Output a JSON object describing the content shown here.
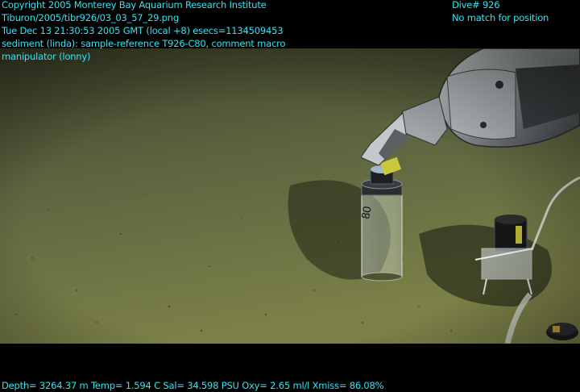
{
  "overlay": {
    "top_left": [
      "Copyright 2005 Monterey Bay Aquarium Research Institute",
      "Tiburon/2005/tibr926/03_03_57_29.png",
      "Tue Dec 13 21:30:53 2005 GMT (local +8)  esecs=1134509453",
      "sediment (linda): sample-reference T926-C80, comment macro",
      "manipulator (lonny)"
    ],
    "top_right": [
      "Dive# 926",
      "No match for position"
    ],
    "bottom": "Depth= 3264.37 m  Temp= 1.594 C  Sal= 34.598 PSU  Oxy= 2.65 ml/l  Xmiss= 86.08%"
  },
  "colors": {
    "overlay_text": "#36e3f0",
    "background": "#000000",
    "seafloor": "#6e7540"
  }
}
